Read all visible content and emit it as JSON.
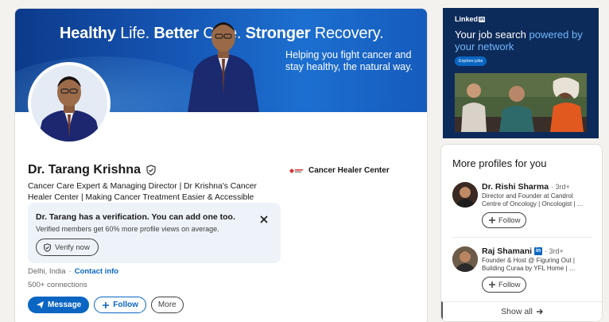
{
  "profile": {
    "banner": {
      "headline_parts": [
        {
          "text": "Healthy",
          "bold": true
        },
        {
          "text": " Life. ",
          "bold": false
        },
        {
          "text": "Better",
          "bold": true
        },
        {
          "text": " Care. ",
          "bold": false
        },
        {
          "text": "Stronger",
          "bold": true
        },
        {
          "text": " Recovery.",
          "bold": false
        }
      ],
      "subline": "Helping you fight cancer and stay healthy, the natural way."
    },
    "name": "Dr. Tarang Krishna",
    "headline": "Cancer Care Expert & Managing Director | Dr Krishna's Cancer Healer Center | Making Cancer Treatment Easier & Accessible",
    "company": "Cancer Healer Center",
    "verification": {
      "title": "Dr. Tarang has a verification. You can add one too.",
      "text": "Verified members get 60% more profile views on average.",
      "button": "Verify now"
    },
    "location": "Delhi, India",
    "separator": "·",
    "contact_label": "Contact info",
    "connections": "500+ connections",
    "actions": {
      "message": "Message",
      "follow": "Follow",
      "more": "More"
    }
  },
  "ad": {
    "brand": "Linked",
    "brand_in": "in",
    "headline_plain": "Your job search ",
    "headline_highlight": "powered by your network",
    "cta": "Explore jobs"
  },
  "more_profiles": {
    "title": "More profiles for you",
    "items": [
      {
        "name": "Dr. Rishi Sharma",
        "degree": "· 3rd+",
        "description": "Director and Founder at Candrol Centre of Oncology | Oncologist | …",
        "follow": "Follow",
        "badge": false
      },
      {
        "name": "Raj Shamani",
        "degree": "· 3rd+",
        "badge_text": "in",
        "description": "Founder & Host @ Figuring Out | Building Curaa by YFL Home | …",
        "follow": "Follow",
        "badge": true
      }
    ],
    "show_all": "Show all"
  },
  "colors": {
    "brand_blue": "#0a66c2",
    "banner_dark": "#0c3a8a",
    "ad_bg": "#0d2b5a",
    "verify_bg": "#edf3f8"
  }
}
